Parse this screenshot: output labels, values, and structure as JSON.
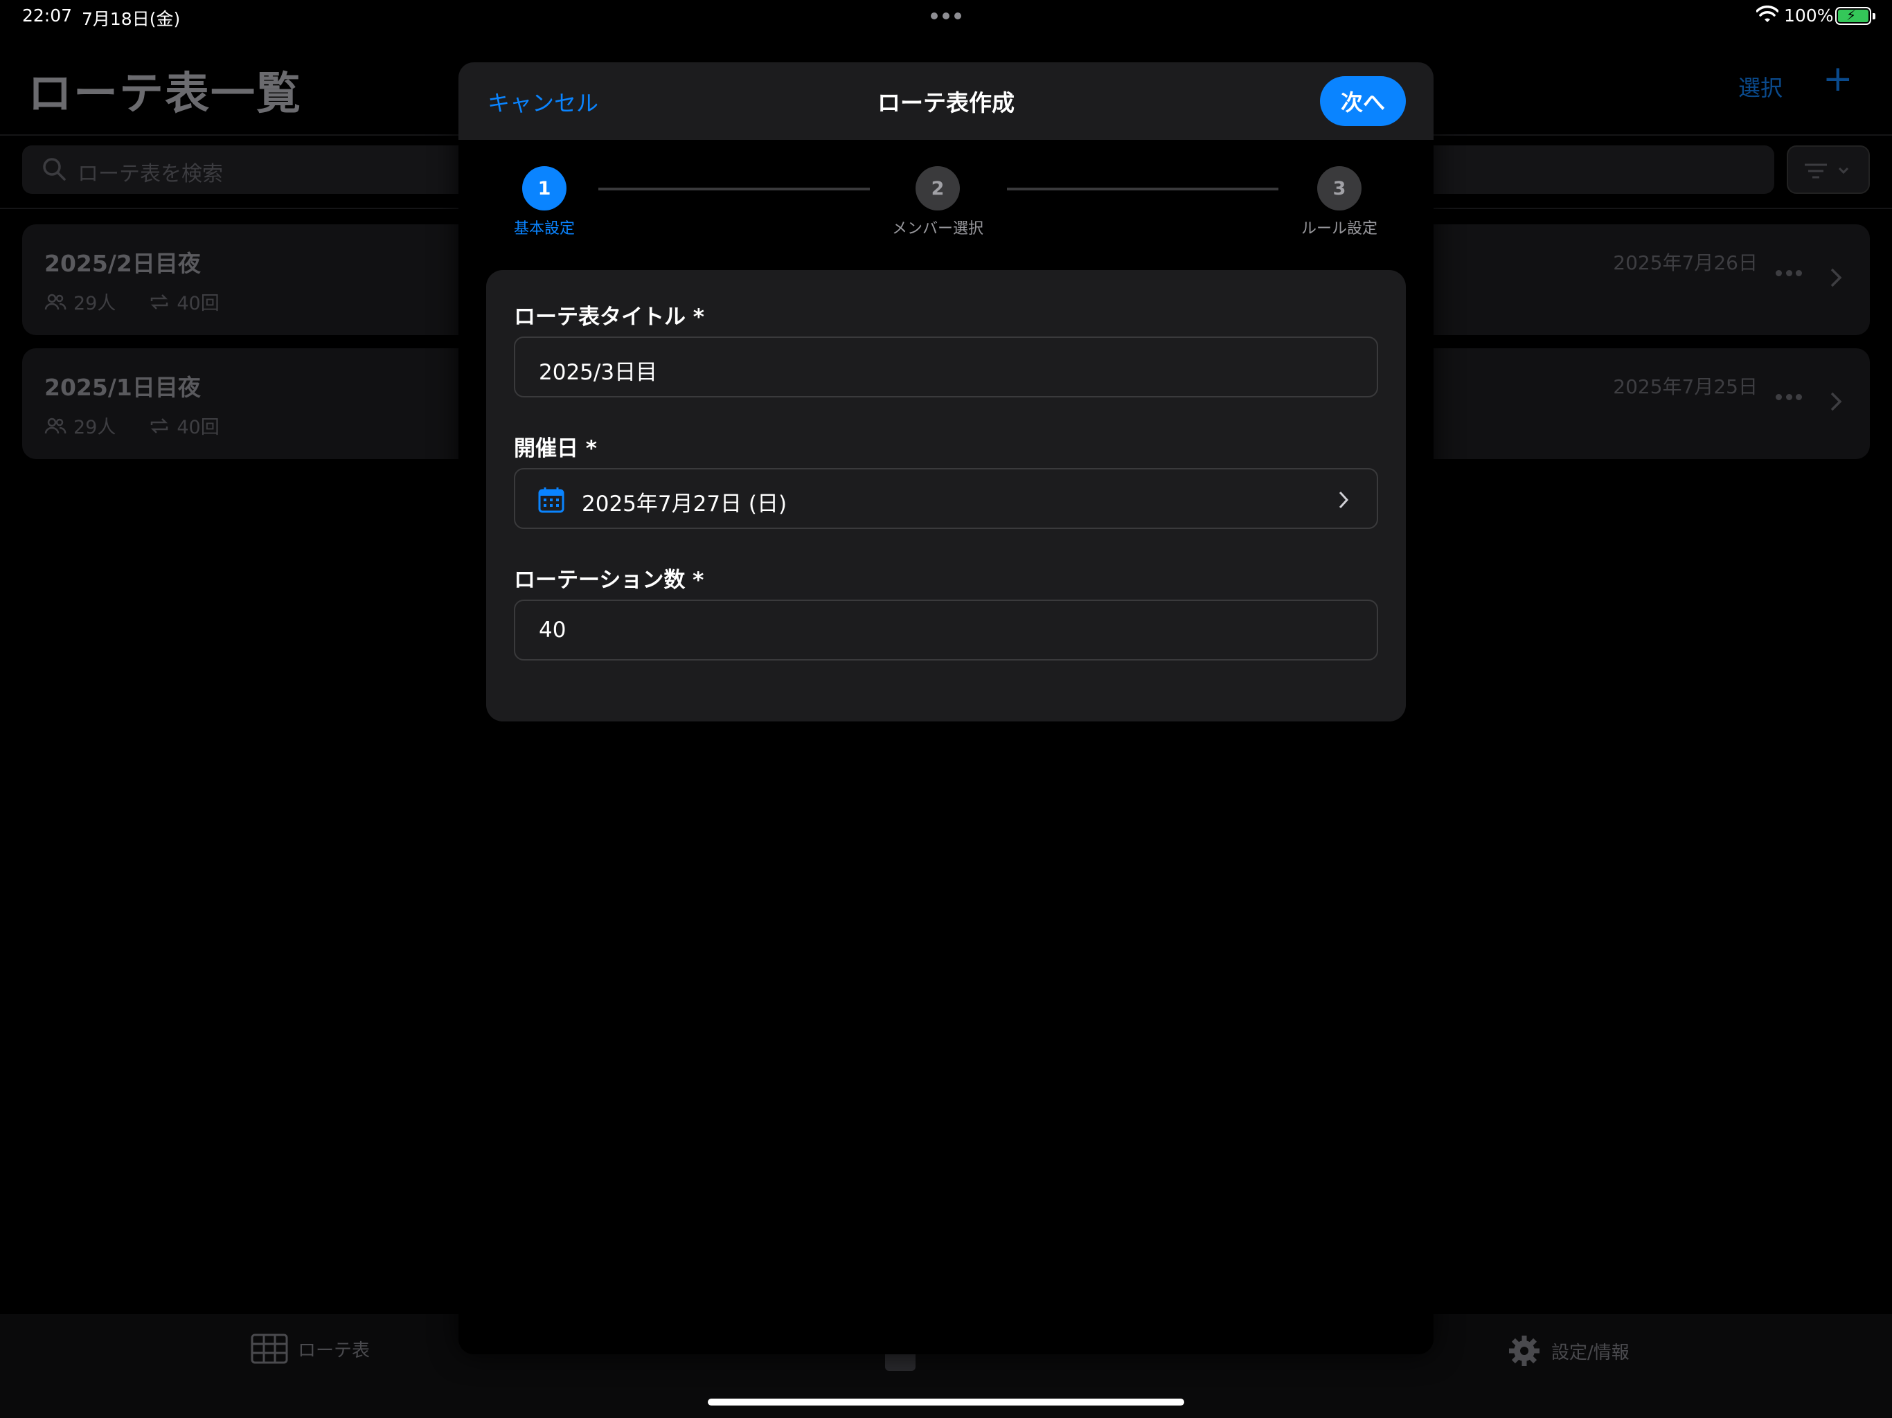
{
  "status_bar": {
    "time": "22:07",
    "date": "7月18日(金)",
    "battery_percent": "100%",
    "battery_level": 1.0
  },
  "background": {
    "page_title": "ローテ表一覧",
    "select_label": "選択",
    "add_icon": "plus-icon",
    "search_placeholder": "ローテ表を検索",
    "rosters": [
      {
        "name": "2025/2日目夜",
        "members": "29人",
        "rotations": "40回",
        "date": "2025年7月26日"
      },
      {
        "name": "2025/1日目夜",
        "members": "29人",
        "rotations": "40回",
        "date": "2025年7月25日"
      }
    ]
  },
  "tab_bar": {
    "roster_label": "ローテ表",
    "settings_label": "設定/情報"
  },
  "sheet": {
    "title": "ローテ表作成",
    "cancel_label": "キャンセル",
    "next_label": "次へ",
    "steps": [
      {
        "number": "1",
        "label": "基本設定",
        "active": true
      },
      {
        "number": "2",
        "label": "メンバー選択",
        "active": false
      },
      {
        "number": "3",
        "label": "ルール設定",
        "active": false
      }
    ],
    "fields": {
      "title_label": "ローテ表タイトル *",
      "title_value": "2025/3日目",
      "date_label": "開催日 *",
      "date_value": "2025年7月27日 (日)",
      "rotation_label": "ローテーション数 *",
      "rotation_value": "40"
    }
  },
  "colors": {
    "accent": "#0a84ff",
    "card": "#1c1c1e",
    "battery": "#34c759"
  }
}
